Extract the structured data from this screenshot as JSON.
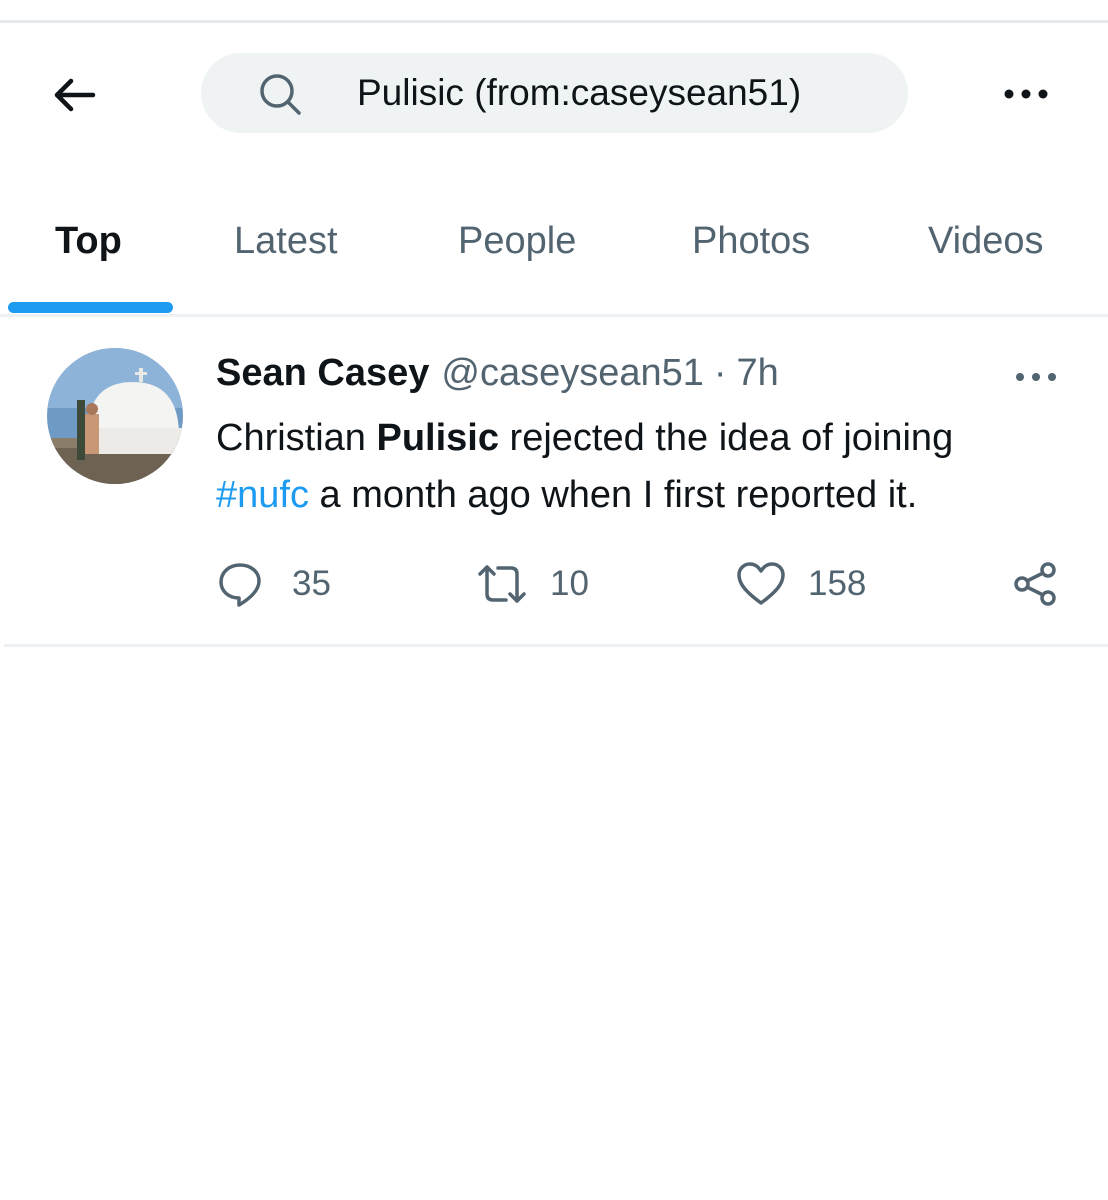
{
  "search": {
    "query": "Pulisic (from:caseysean51)"
  },
  "icons": {
    "back": "arrow-left-icon",
    "search": "search-icon",
    "more": "more-horizontal-icon",
    "reply": "reply-icon",
    "retweet": "retweet-icon",
    "like": "heart-icon",
    "share": "share-icon"
  },
  "tabs": [
    {
      "label": "Top",
      "active": true
    },
    {
      "label": "Latest",
      "active": false
    },
    {
      "label": "People",
      "active": false
    },
    {
      "label": "Photos",
      "active": false
    },
    {
      "label": "Videos",
      "active": false
    }
  ],
  "tweet": {
    "name": "Sean Casey",
    "handle": "@caseysean51",
    "separator": "·",
    "time": "7h",
    "text": {
      "part1": "Christian ",
      "bold": "Pulisic",
      "part2": " rejected the idea of joining ",
      "hashtag": "#nufc",
      "part3": " a month ago when I first reported it."
    },
    "replies": "35",
    "retweets": "10",
    "likes": "158"
  },
  "colors": {
    "accent": "#1d9bf0",
    "text_primary": "#0f1419",
    "text_secondary": "#536471",
    "search_bg": "#eff3f4"
  }
}
